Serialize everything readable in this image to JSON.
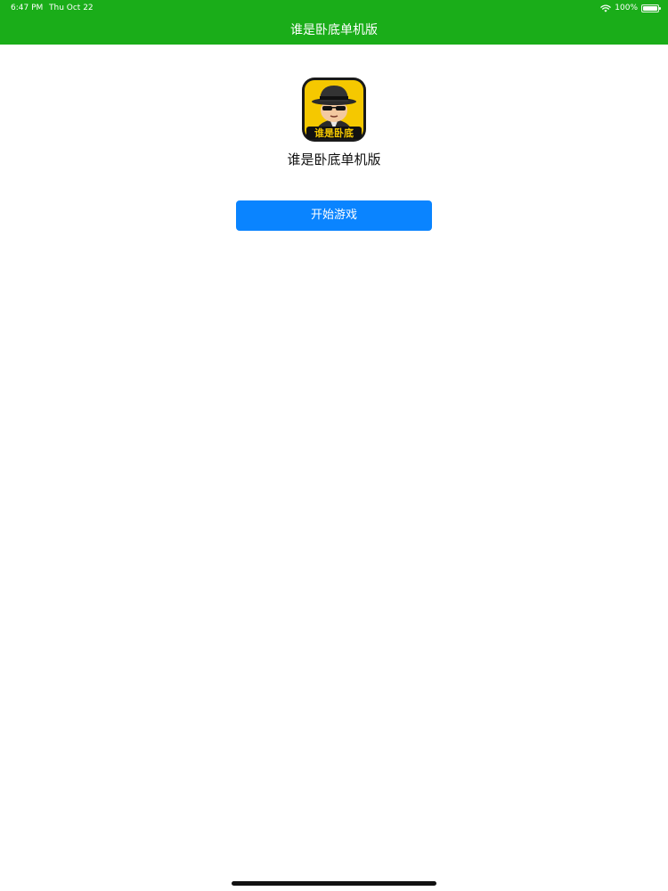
{
  "status_bar": {
    "time": "6:47 PM",
    "date": "Thu Oct 22",
    "battery_text": "100%",
    "battery_level": 1.0,
    "wifi_icon": "wifi-icon"
  },
  "nav": {
    "title": "谁是卧底单机版",
    "background_color": "#1aad19"
  },
  "app": {
    "icon_text": "谁是卧底",
    "name": "谁是卧底单机版",
    "icon_background": "#f5c800"
  },
  "actions": {
    "start_label": "开始游戏",
    "start_color": "#0a84ff"
  }
}
